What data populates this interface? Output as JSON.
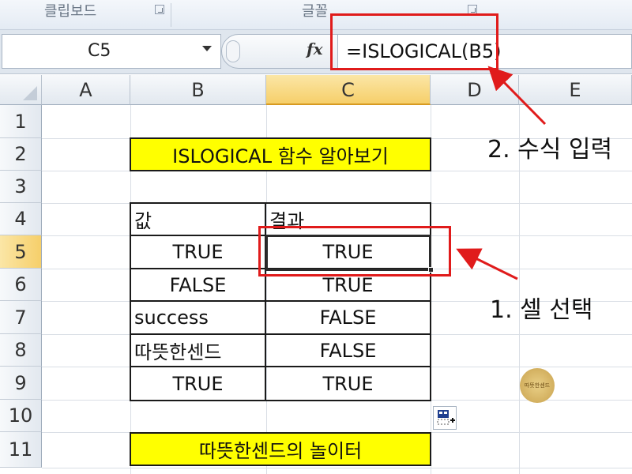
{
  "ribbon": {
    "group1": "클립보드",
    "group2": "글꼴"
  },
  "formula_bar": {
    "name_box": "C5",
    "fx_symbol": "fx",
    "formula": "=ISLOGICAL(B5)"
  },
  "columns": [
    "A",
    "B",
    "C",
    "D",
    "E"
  ],
  "rows": [
    "1",
    "2",
    "3",
    "4",
    "5",
    "6",
    "7",
    "8",
    "9",
    "10",
    "11"
  ],
  "sheet": {
    "title": "ISLOGICAL 함수 알아보기",
    "header_value": "값",
    "header_result": "결과",
    "b5": "TRUE",
    "c5": "TRUE",
    "b6": "FALSE",
    "c6": "TRUE",
    "b7": "success",
    "c7": "FALSE",
    "b8": "따뜻한센드",
    "c8": "FALSE",
    "b9": "TRUE",
    "c9": "TRUE",
    "footer": "따뜻한센드의 놀이터"
  },
  "annotations": {
    "step1": "1. 셀 선택",
    "step2": "2. 수식 입력"
  },
  "watermark_text": "따뜻한센드",
  "colors": {
    "highlight_red": "#e01b1b",
    "title_yellow": "#ffff00",
    "selected_header": "#f6cf6a"
  }
}
